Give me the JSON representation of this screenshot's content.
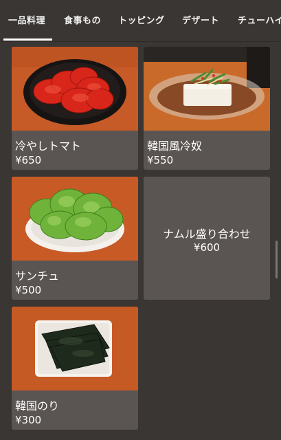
{
  "tabs": [
    {
      "label": "一品料理",
      "active": true
    },
    {
      "label": "食事もの",
      "active": false
    },
    {
      "label": "トッピング",
      "active": false
    },
    {
      "label": "デザート",
      "active": false
    },
    {
      "label": "チューハイ",
      "active": false
    }
  ],
  "items": [
    {
      "name": "冷やしトマト",
      "price": "¥650",
      "image": "tomato-plate"
    },
    {
      "name": "韓国風冷奴",
      "price": "¥550",
      "image": "tofu-dish"
    },
    {
      "name": "サンチュ",
      "price": "¥500",
      "image": "lettuce-plate"
    },
    {
      "name": "ナムル盛り合わせ",
      "price": "¥600",
      "image": null
    },
    {
      "name": "韓国のり",
      "price": "¥300",
      "image": "seaweed-plate"
    }
  ],
  "colors": {
    "background": "#3a3633",
    "card": "#5a5552",
    "photo_backdrop": "#c85a26",
    "text": "#ffffff"
  }
}
